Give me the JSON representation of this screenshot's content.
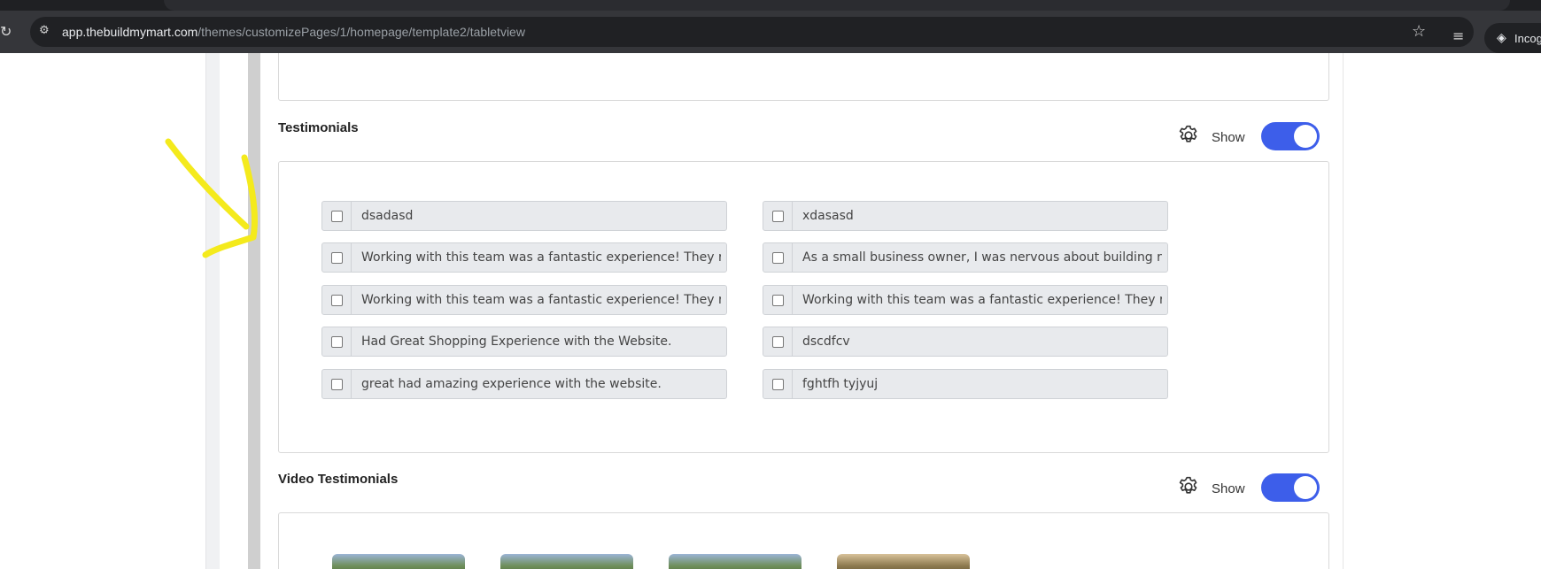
{
  "browser": {
    "url_host": "app.thebuildmymart.com",
    "url_path": "/themes/customizePages/1/homepage/template2/tabletview",
    "incognito_label": "Incog"
  },
  "icons": {
    "reload": "reload-icon",
    "site_info": "tune-icon",
    "bookmark": "star-icon",
    "media": "media-queue-icon",
    "incognito": "incognito-icon",
    "settings": "gear-icon"
  },
  "testimonials": {
    "title": "Testimonials",
    "show_label": "Show",
    "show_enabled": true,
    "items": [
      {
        "text": "dsadasd",
        "checked": false
      },
      {
        "text": "xdasasd",
        "checked": false
      },
      {
        "text": "Working with this team was a fantastic experience! They r",
        "checked": false
      },
      {
        "text": "As a small business owner, I was nervous about building r",
        "checked": false
      },
      {
        "text": "Working with this team was a fantastic experience! They r",
        "checked": false
      },
      {
        "text": "Working with this team was a fantastic experience! They r",
        "checked": false
      },
      {
        "text": "Had Great Shopping Experience with the Website.",
        "checked": false
      },
      {
        "text": "dscdfcv",
        "checked": false
      },
      {
        "text": "great had amazing experience with the website.",
        "checked": false
      },
      {
        "text": "fghtfh tyjyuj",
        "checked": false
      }
    ]
  },
  "video_testimonials": {
    "title": "Video Testimonials",
    "show_label": "Show",
    "show_enabled": true
  },
  "colors": {
    "toggle_on": "#3d5eea",
    "annotation": "#f4ea1c"
  }
}
